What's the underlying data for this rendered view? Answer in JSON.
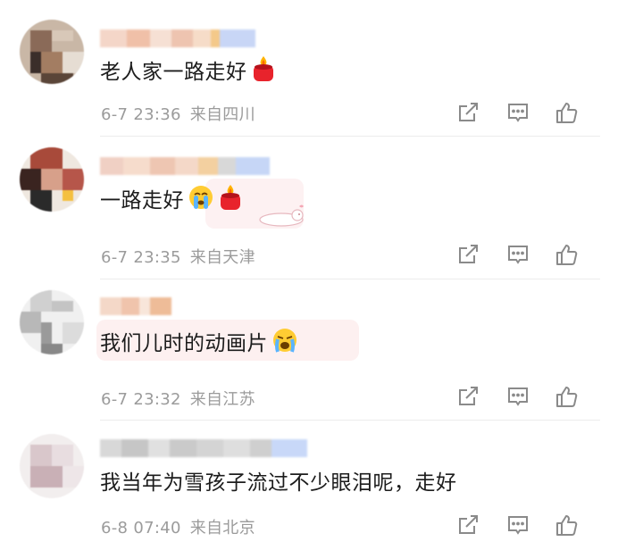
{
  "comments": [
    {
      "text": "老人家一路走好",
      "date": "6-7 23:36",
      "location": "来自四川",
      "emojis": [
        "candle-emoji"
      ]
    },
    {
      "text": "一路走好",
      "date": "6-7 23:35",
      "location": "来自天津",
      "emojis": [
        "crying-face-emoji",
        "candle-emoji"
      ]
    },
    {
      "text": "我们儿时的动画片",
      "date": "6-7 23:32",
      "location": "来自江苏",
      "emojis": [
        "loudly-crying-face-emoji"
      ]
    },
    {
      "text": "我当年为雪孩子流过不少眼泪呢，走好",
      "date": "6-8 07:40",
      "location": "来自北京",
      "emojis": []
    }
  ],
  "actions": [
    "share-icon",
    "reply-icon",
    "like-icon"
  ],
  "colors": {
    "meta_text": "#9b9b9b",
    "icon_stroke": "#8a8a8a",
    "divider": "#ececec",
    "candle_red": "#e8232c",
    "flame": "#ffb300"
  }
}
